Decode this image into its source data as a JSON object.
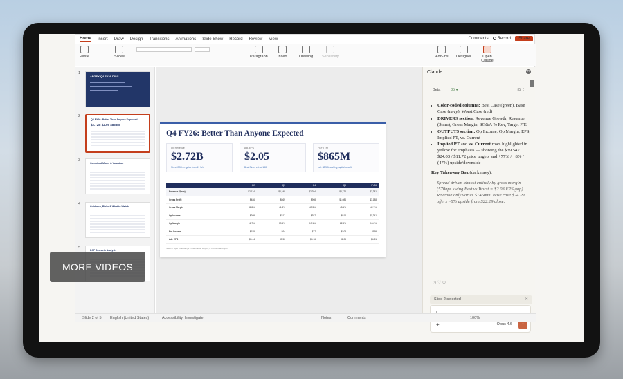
{
  "ribbon_tabs": [
    "Home",
    "Insert",
    "Draw",
    "Design",
    "Transitions",
    "Animations",
    "Slide Show",
    "Record",
    "Review",
    "View"
  ],
  "ribbon_right": {
    "comments": "Comments",
    "record": "Record",
    "share": "Share"
  },
  "ribbon_groups": {
    "paste": "Paste",
    "slides": "Slides",
    "paragraph": "Paragraph",
    "insert": "Insert",
    "drawing": "Drawing",
    "sensitivity": "Sensitivity",
    "addins": "Add-ins",
    "designer": "Designer",
    "open_claude": "Open Claude"
  },
  "thumbnails": [
    {
      "num": "1",
      "title": "AFGEY Q4 FY26 DISC"
    },
    {
      "num": "2",
      "title": "Q4 FY26: Better Than Anyone Expected",
      "kpis": "$2.72B   $2.05   $865M"
    },
    {
      "num": "3",
      "title": "Combined Model & Valuation"
    },
    {
      "num": "4",
      "title": "Guidance, Risks & What to Watch"
    },
    {
      "num": "5",
      "title": "DCF Scenario Analysis"
    }
  ],
  "slide": {
    "title": "Q4 FY26: Better Than Anyone Expected",
    "cards": [
      {
        "label": "Q4 Revenue",
        "value": "$2.72B",
        "sub": "Street 2.58 ex. guide from 41 YoY"
      },
      {
        "label": "Adj. EPS",
        "value": "$2.05",
        "sub": "Beat Street est. of 1.80"
      },
      {
        "label": "FCF TTM",
        "value": "$865M",
        "sub": "Incl. $226M working capital benefit"
      }
    ],
    "table_head": [
      "",
      "Q2",
      "Q3",
      "Q4",
      "Q5",
      "FY26"
    ],
    "rows": [
      [
        "Revenue ($mm)",
        "$2,134",
        "$2,249",
        "$2,294",
        "$2,724",
        "$7,281"
      ],
      [
        "Gross Profit",
        "$486",
        "$669",
        "$908",
        "$1,084",
        "$3,188"
      ],
      [
        "Gross Margin",
        "41.8%",
        "41.3%",
        "43.3%",
        "45.1%",
        "42.7%"
      ],
      [
        "Op Income",
        "$209",
        "$317",
        "$387",
        "$614",
        "$1,241"
      ],
      [
        "Op Margin",
        "16.7%",
        "19.5%",
        "19.1%",
        "22.5%",
        "15.6%"
      ],
      [
        "Net Income",
        "$155",
        "$64",
        "$77",
        "$403",
        "$699"
      ],
      [
        "Adj. EPS",
        "$0.44",
        "$0.50",
        "$0.16",
        "$1.05",
        "$4.31"
      ]
    ],
    "footnote": "Source: April Investor Q4 Presentation Report; FY26 Annual Report"
  },
  "claude": {
    "header": "Claude",
    "tab_beta": "Beta",
    "tab_status": "85 ●",
    "bullets": [
      {
        "bold": "Color-coded columns:",
        "text": " Best Case (green), Base Case (navy), Worst Case (red)"
      },
      {
        "bold": "DRIVERS section:",
        "text": " Revenue Growth, Revenue ($mm), Gross Margin, SG&A % Rev, Target P/E"
      },
      {
        "bold": "OUTPUTS section:",
        "text": " Op Income, Op Margin, EPS, Implied PT, vs. Current"
      },
      {
        "bold": "Implied PT",
        "text": " and "
      },
      {
        "bold": "vs. Current",
        "text": " rows highlighted in yellow for emphasis — showing the $39.54 / $24.03 / $11.72 price targets and +77% / +8% / (47%) upside/downside"
      }
    ],
    "key_title": "Key Takeaway Box",
    "key_suffix": " (dark navy):",
    "quote": "Spread driven almost entirely by gross margin (570bps swing Best vs Worst = $2.03 EPS gap). Revenue only varies $146mm. Base case $24 PT offers ~8% upside from $22.29 close.",
    "feedback": "◷ ♡ ⊙",
    "selected": "Slide 2 selected",
    "input_value": "I",
    "model": "Opus 4.6",
    "plus": "+"
  },
  "statusbar": {
    "slide": "Slide 2 of 5",
    "lang": "English (United States)",
    "access": "Accessibility: Investigate",
    "notes": "Notes",
    "comments": "Comments",
    "zoom": "100%"
  },
  "overlay": {
    "more_videos": "MORE VIDEOS"
  }
}
